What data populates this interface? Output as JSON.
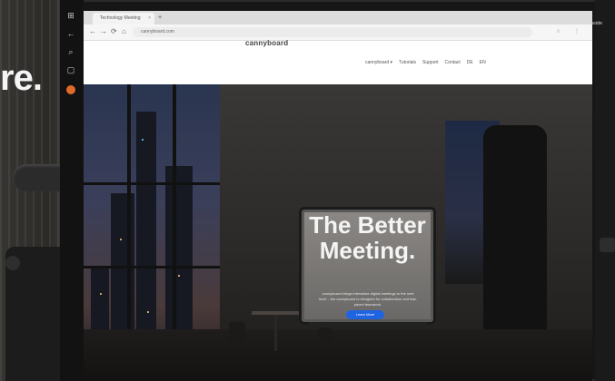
{
  "browser": {
    "tab_title": "Technology Meeting",
    "new_tab": "+",
    "close_tab": "×",
    "url": "cannyboard.com",
    "nav": {
      "back": "←",
      "forward": "→",
      "reload": "⟳",
      "home": "⌂"
    },
    "extensions": [
      "☆",
      "⋮"
    ]
  },
  "site": {
    "logo": "cannyboard",
    "nav_items": [
      "cannyboard ▾",
      "Tutorials",
      "Support",
      "Contact",
      "DE",
      "EN"
    ],
    "hero": {
      "headline_line1": "The Better",
      "headline_line2": "Meeting.",
      "body": "cannyboard brings interactive digital meetings to the next level – the cannyboard is designed for collaboration and fast-paced teamwork.",
      "cta": "Learn More"
    }
  },
  "overlay": {
    "tagline_fragment": "re.",
    "badge": "Technology Inside"
  },
  "taskbar": {
    "icons": [
      "windows-icon",
      "back-icon",
      "search-icon",
      "task-view-icon",
      "browser-icon"
    ]
  },
  "colors": {
    "cta": "#1e63e0",
    "badge_mark": "#4aa3df"
  }
}
